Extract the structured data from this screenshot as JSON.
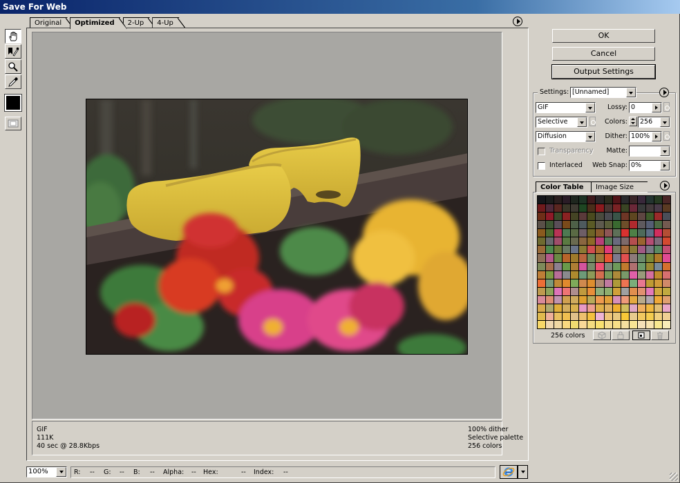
{
  "window": {
    "title": "Save For Web"
  },
  "tools": [
    {
      "name": "hand-tool",
      "active": true
    },
    {
      "name": "slice-select-tool",
      "active": false
    },
    {
      "name": "zoom-tool",
      "active": false
    },
    {
      "name": "eyedropper-tool",
      "active": false
    }
  ],
  "eyedropper_color": "#000000",
  "view_tabs": [
    {
      "label": "Original",
      "active": false
    },
    {
      "label": "Optimized",
      "active": true
    },
    {
      "label": "2-Up",
      "active": false
    },
    {
      "label": "4-Up",
      "active": false
    }
  ],
  "info": {
    "format": "GIF",
    "size": "111K",
    "download_time": "40 sec @ 28.8Kbps",
    "dither": "100% dither",
    "palette": "Selective palette",
    "colors": "256 colors"
  },
  "status_bar": {
    "zoom": "100%",
    "r_label": "R:",
    "r_value": "--",
    "g_label": "G:",
    "g_value": "--",
    "b_label": "B:",
    "b_value": "--",
    "alpha_label": "Alpha:",
    "alpha_value": "--",
    "hex_label": "Hex:",
    "hex_value": "--",
    "index_label": "Index:",
    "index_value": "--"
  },
  "buttons": {
    "ok": "OK",
    "cancel": "Cancel",
    "output_settings": "Output Settings"
  },
  "settings": {
    "label": "Settings:",
    "preset": "[Unnamed]",
    "format": "GIF",
    "palette": "Selective",
    "dither_algorithm": "Diffusion",
    "lossy_label": "Lossy:",
    "lossy": "0",
    "colors_label": "Colors:",
    "colors": "256",
    "dither_label": "Dither:",
    "dither": "100%",
    "matte_label": "Matte:",
    "matte": "",
    "transparency_label": "Transparency",
    "transparency_checked": false,
    "transparency_enabled": false,
    "interlaced_label": "Interlaced",
    "interlaced_checked": false,
    "web_snap_label": "Web Snap:",
    "web_snap": "0%"
  },
  "color_table": {
    "tabs": [
      {
        "label": "Color Table",
        "active": true
      },
      {
        "label": "Image Size",
        "active": false
      }
    ],
    "count_label": "256 colors",
    "swatches": [
      "#15161a",
      "#1c1d1c",
      "#2a1e1e",
      "#2a1c26",
      "#1e261e",
      "#1e3324",
      "#3e1a1c",
      "#2a2628",
      "#2a2a1c",
      "#521418",
      "#2a2a2c",
      "#3a2628",
      "#38283a",
      "#243430",
      "#263a22",
      "#4a2626",
      "#6e1a1c",
      "#4e2a3a",
      "#5a2620",
      "#3a3628",
      "#3e3a32",
      "#1e4622",
      "#4a2e1a",
      "#8a1a1e",
      "#4a3430",
      "#7a2224",
      "#3a4424",
      "#6a2838",
      "#383a3a",
      "#443a3c",
      "#483a48",
      "#5a3a22",
      "#6e2e18",
      "#8e1a28",
      "#3a4a2a",
      "#8a2222",
      "#444424",
      "#5a3a3a",
      "#4a4a1e",
      "#4a4a3e",
      "#4a4a50",
      "#3a5448",
      "#6e3626",
      "#5e4620",
      "#5e4642",
      "#3e5a2a",
      "#9a2a2a",
      "#4a4e58",
      "#5a5048",
      "#3e5634",
      "#5a4e58",
      "#7a4a1a",
      "#4e6048",
      "#4e5a5e",
      "#5a5a26",
      "#5e5a4e",
      "#5a5e3a",
      "#3a6a30",
      "#6e4e2a",
      "#b02a2e",
      "#5e5a5e",
      "#565e74",
      "#4e6a44",
      "#745a50",
      "#8a5a1e",
      "#4e6a30",
      "#b83456",
      "#4e7a52",
      "#5a6a44",
      "#6e5e66",
      "#6e6426",
      "#8a5a2e",
      "#8e5656",
      "#5e7058",
      "#d83230",
      "#4e8046",
      "#4e6a5a",
      "#5e6e86",
      "#d02e5e",
      "#b44e34",
      "#6e6a30",
      "#686a6e",
      "#a04e6a",
      "#5a7a42",
      "#6a6a50",
      "#8a6640",
      "#8e6a28",
      "#b84078",
      "#5a7a5a",
      "#6a6a7e",
      "#7e6a6a",
      "#b44e4e",
      "#9a6430",
      "#b44e74",
      "#7e6a7a",
      "#d44a30",
      "#9a6a38",
      "#4e8a4e",
      "#6e7a38",
      "#6a7a62",
      "#6a7488",
      "#8a7a34",
      "#d04e50",
      "#ae6a2e",
      "#e03a7a",
      "#7a7a62",
      "#a86a3a",
      "#8a7a38",
      "#a05a84",
      "#7a7a86",
      "#5a8a62",
      "#c44e74",
      "#8e7058",
      "#b45a8a",
      "#6a8a44",
      "#b8642a",
      "#9e7a2a",
      "#b8643e",
      "#6e8a5a",
      "#9e7a3a",
      "#e85234",
      "#7e7a8e",
      "#e05050",
      "#8e7a7a",
      "#6a8a6a",
      "#7a8a3a",
      "#ae7a2a",
      "#e04a94",
      "#7e8a5a",
      "#a8704e",
      "#8e8090",
      "#6a9a4a",
      "#ae7e34",
      "#d4549e",
      "#7a8a6a",
      "#ee5070",
      "#7e8a7a",
      "#6e9a5a",
      "#c07a2e",
      "#b07070",
      "#6e9a6a",
      "#9a8a34",
      "#788a9a",
      "#d4702e",
      "#be7e36",
      "#7e9a44",
      "#b86e98",
      "#8a8a8e",
      "#ae8a2e",
      "#6e9a78",
      "#8e9a58",
      "#d46e50",
      "#7a9a5a",
      "#ae8a3a",
      "#7a9a6a",
      "#e060a8",
      "#9a9a7a",
      "#d470a0",
      "#c08a2e",
      "#d87070",
      "#ee6e36",
      "#7a9a7a",
      "#c08a38",
      "#e08a2e",
      "#7eaa5a",
      "#d08a4e",
      "#de8e2e",
      "#ae8a74",
      "#c07aa0",
      "#ae9a3a",
      "#ee7452",
      "#7aae7a",
      "#e87890",
      "#be9a34",
      "#d09a3a",
      "#d08a6a",
      "#be9a4e",
      "#8ea45a",
      "#de74b8",
      "#ee7474",
      "#ae8e8e",
      "#c09a3e",
      "#e88e3a",
      "#8eae7a",
      "#8eae6e",
      "#d0a03a",
      "#a0a0a0",
      "#e08e4e",
      "#e09070",
      "#e47ab8",
      "#d0a840",
      "#c0aa40",
      "#d88a9a",
      "#de8e74",
      "#c094b0",
      "#d0a050",
      "#ceaa5e",
      "#e0a030",
      "#b8aa5a",
      "#ee9a50",
      "#e0a03a",
      "#d890b8",
      "#ee9a7a",
      "#e4a840",
      "#b8aa8a",
      "#b0a8b0",
      "#eea838",
      "#e0a070",
      "#d8aa4e",
      "#aeaa70",
      "#e0ae3a",
      "#d4ae5e",
      "#d8b04e",
      "#e89ac4",
      "#ee9e90",
      "#e0b04a",
      "#e0b060",
      "#f0b030",
      "#d0be5e",
      "#e0a8c4",
      "#f0b060",
      "#f0b840",
      "#e0be74",
      "#eaa8c8",
      "#e0ba4e",
      "#eeb09a",
      "#e8c060",
      "#f0c050",
      "#e0c08a",
      "#eec06e",
      "#f4c040",
      "#eeb4d4",
      "#eec478",
      "#e8c880",
      "#f8c838",
      "#e8cc8e",
      "#f0c860",
      "#f4cc50",
      "#f0d080",
      "#f0d094",
      "#f8d868",
      "#f0d8b0",
      "#f0d8a4",
      "#f8d880",
      "#f0dc70",
      "#f8d898",
      "#f4dc80",
      "#f8e070",
      "#f4dc90",
      "#f8e088",
      "#f4e0a0",
      "#f8e494",
      "#f4e0b8",
      "#f8e4b0",
      "#f8e890",
      "#f8ecb8"
    ]
  },
  "photo": {
    "subject": "yellow wooden clogs with flowers"
  }
}
